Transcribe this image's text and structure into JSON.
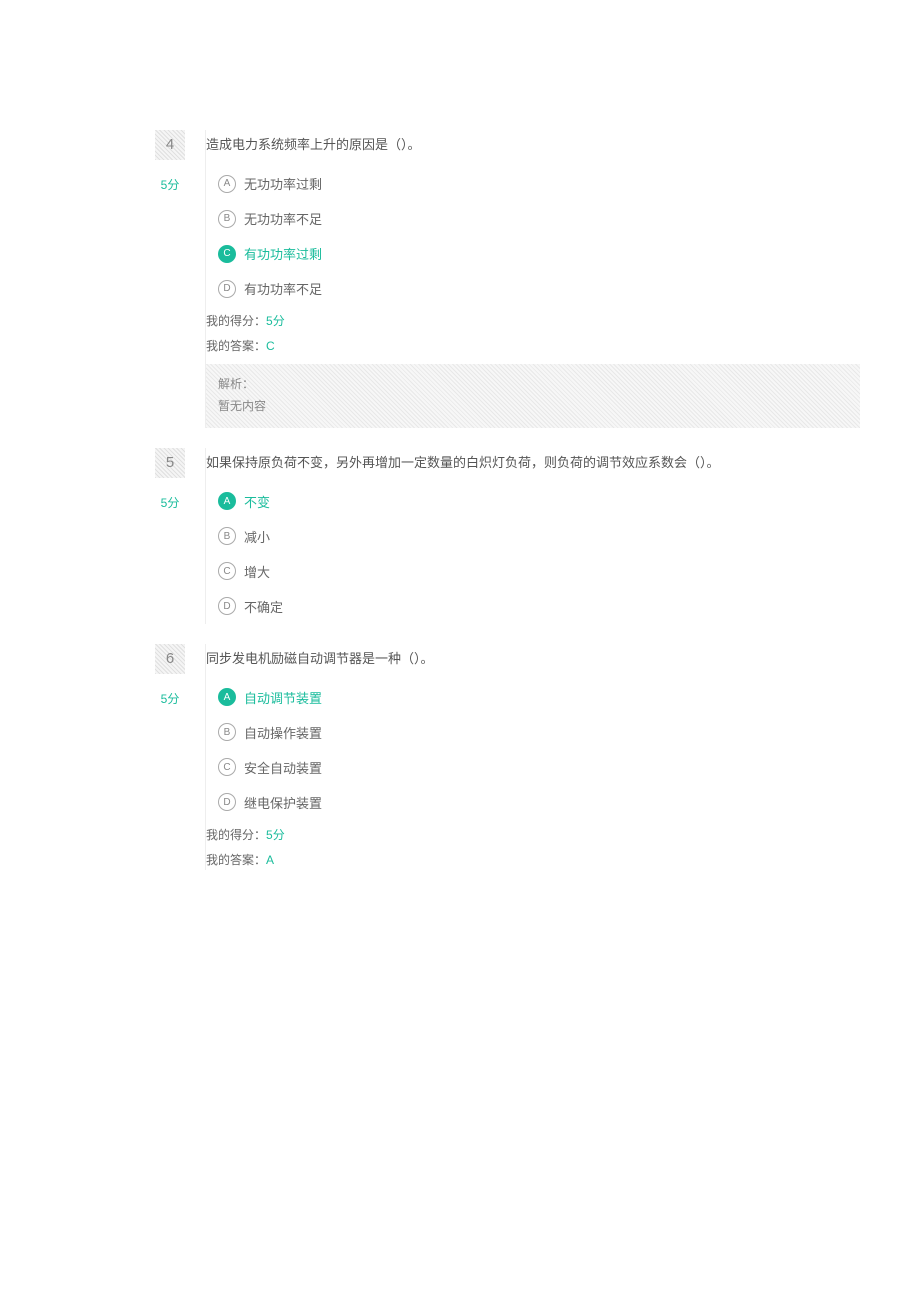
{
  "questions": [
    {
      "number": "4",
      "score": "5分",
      "text": "造成电力系统频率上升的原因是（）。",
      "options": [
        {
          "letter": "A",
          "text": "无功功率过剩",
          "selected": false
        },
        {
          "letter": "B",
          "text": "无功功率不足",
          "selected": false
        },
        {
          "letter": "C",
          "text": "有功功率过剩",
          "selected": true
        },
        {
          "letter": "D",
          "text": "有功功率不足",
          "selected": false
        }
      ],
      "my_score_label": "我的得分：",
      "my_score_value": "5分",
      "my_answer_label": "我的答案：",
      "my_answer_value": "C",
      "show_result": true,
      "explain_title": "解析：",
      "explain_body": "暂无内容",
      "show_explain": true
    },
    {
      "number": "5",
      "score": "5分",
      "text": "如果保持原负荷不变，另外再增加一定数量的白炽灯负荷，则负荷的调节效应系数会（）。",
      "options": [
        {
          "letter": "A",
          "text": "不变",
          "selected": true
        },
        {
          "letter": "B",
          "text": "减小",
          "selected": false
        },
        {
          "letter": "C",
          "text": "增大",
          "selected": false
        },
        {
          "letter": "D",
          "text": "不确定",
          "selected": false
        }
      ],
      "show_result": false,
      "show_explain": false
    },
    {
      "number": "6",
      "score": "5分",
      "text": "同步发电机励磁自动调节器是一种（）。",
      "options": [
        {
          "letter": "A",
          "text": "自动调节装置",
          "selected": true
        },
        {
          "letter": "B",
          "text": "自动操作装置",
          "selected": false
        },
        {
          "letter": "C",
          "text": "安全自动装置",
          "selected": false
        },
        {
          "letter": "D",
          "text": "继电保护装置",
          "selected": false
        }
      ],
      "my_score_label": "我的得分：",
      "my_score_value": "5分",
      "my_answer_label": "我的答案：",
      "my_answer_value": "A",
      "show_result": true,
      "show_explain": false
    }
  ]
}
